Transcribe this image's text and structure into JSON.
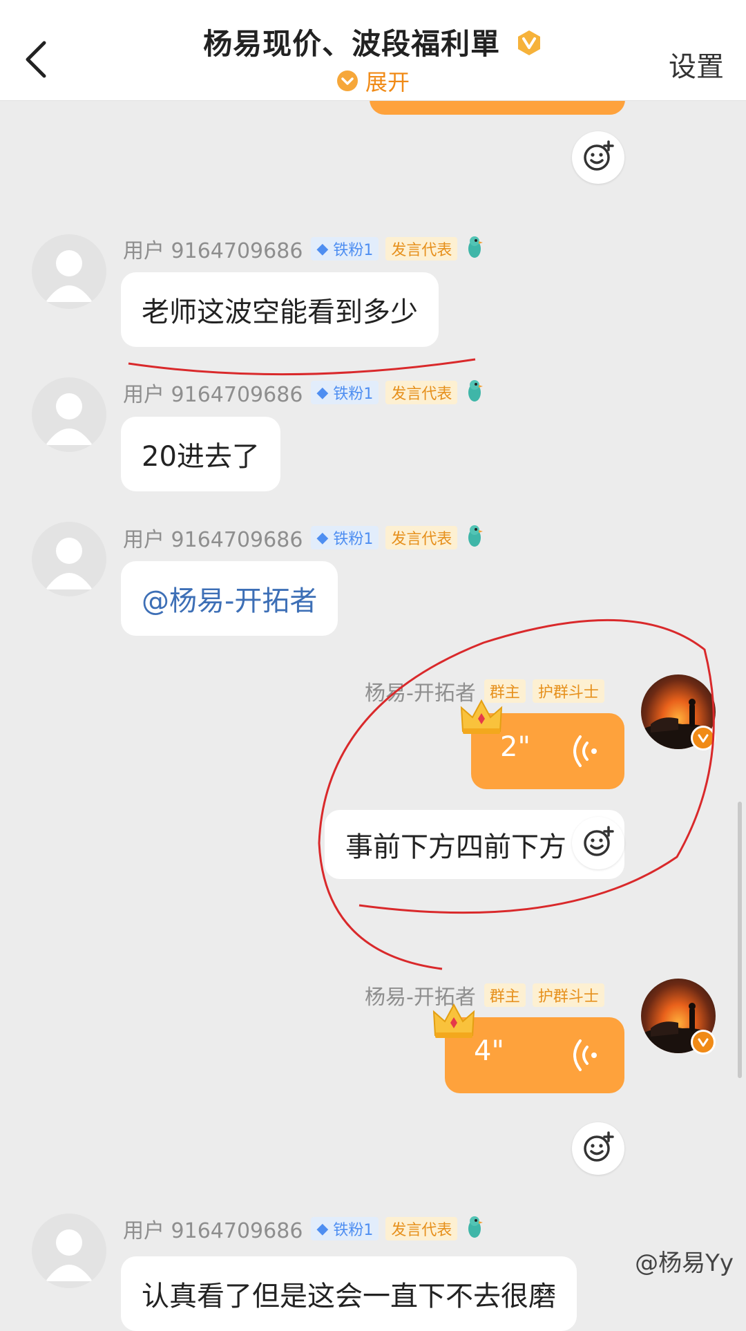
{
  "header": {
    "title": "杨易现价、波段福利單",
    "expand_label": "展开",
    "settings_label": "设置"
  },
  "colors": {
    "accent": "#fea23c",
    "orange_text": "#f08a16",
    "annotation_red": "#d9292b"
  },
  "icons": {
    "back": "chevron-left-icon",
    "verified": "verified-v-icon",
    "reaction": "emoji-add-icon",
    "voice": "voice-wave-icon",
    "crown": "crown-icon",
    "bird_badge": "bird-badge-icon"
  },
  "messages": [
    {
      "user": "用户 9164709686",
      "fan_badge": "铁粉1",
      "role_badge": "发言代表",
      "text": "老师这波空能看到多少"
    },
    {
      "user": "用户 9164709686",
      "fan_badge": "铁粉1",
      "role_badge": "发言代表",
      "text": "20进去了"
    },
    {
      "user": "用户 9164709686",
      "fan_badge": "铁粉1",
      "role_badge": "发言代表",
      "text": "@杨易-开拓者"
    },
    {
      "user": "杨易-开拓者",
      "owner_badge": "群主",
      "guard_badge": "护群斗士",
      "voice_duration": "2\""
    },
    {
      "text": "事前下方四前下方"
    },
    {
      "user": "杨易-开拓者",
      "owner_badge": "群主",
      "guard_badge": "护群斗士",
      "voice_duration": "4\""
    },
    {
      "user": "用户 9164709686",
      "fan_badge": "铁粉1",
      "role_badge": "发言代表",
      "text": "认真看了但是这会一直下不去很磨"
    }
  ],
  "watermark": "@杨易Yy"
}
